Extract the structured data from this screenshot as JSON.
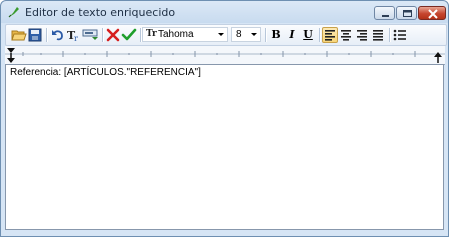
{
  "window": {
    "title": "Editor de texto enriquecido",
    "icon": "quill-pen-icon",
    "controls": [
      "minimize",
      "maximize",
      "close"
    ]
  },
  "toolbar": {
    "buttons": [
      {
        "name": "open-icon",
        "tooltip": ""
      },
      {
        "name": "save-icon",
        "tooltip": ""
      },
      {
        "name": "undo-icon",
        "tooltip": ""
      },
      {
        "name": "font-format-icon",
        "tooltip": ""
      },
      {
        "name": "insert-field-icon",
        "tooltip": ""
      },
      {
        "name": "cancel-icon",
        "color": "#d61e1e"
      },
      {
        "name": "accept-icon",
        "color": "#1e9e2c"
      }
    ],
    "font_icon_label": "Tr",
    "font_name": "Tahoma",
    "font_size": "8",
    "bold_label": "B",
    "italic_label": "I",
    "underline_label": "U",
    "alignment_selected": "left"
  },
  "editor": {
    "content": "Referencia: [ARTÍCULOS.\"REFERENCIA\"]"
  },
  "colors": {
    "titlebar": "#c8dbef",
    "close_button": "#c6462f",
    "selected_tool": "#f8d67a"
  }
}
